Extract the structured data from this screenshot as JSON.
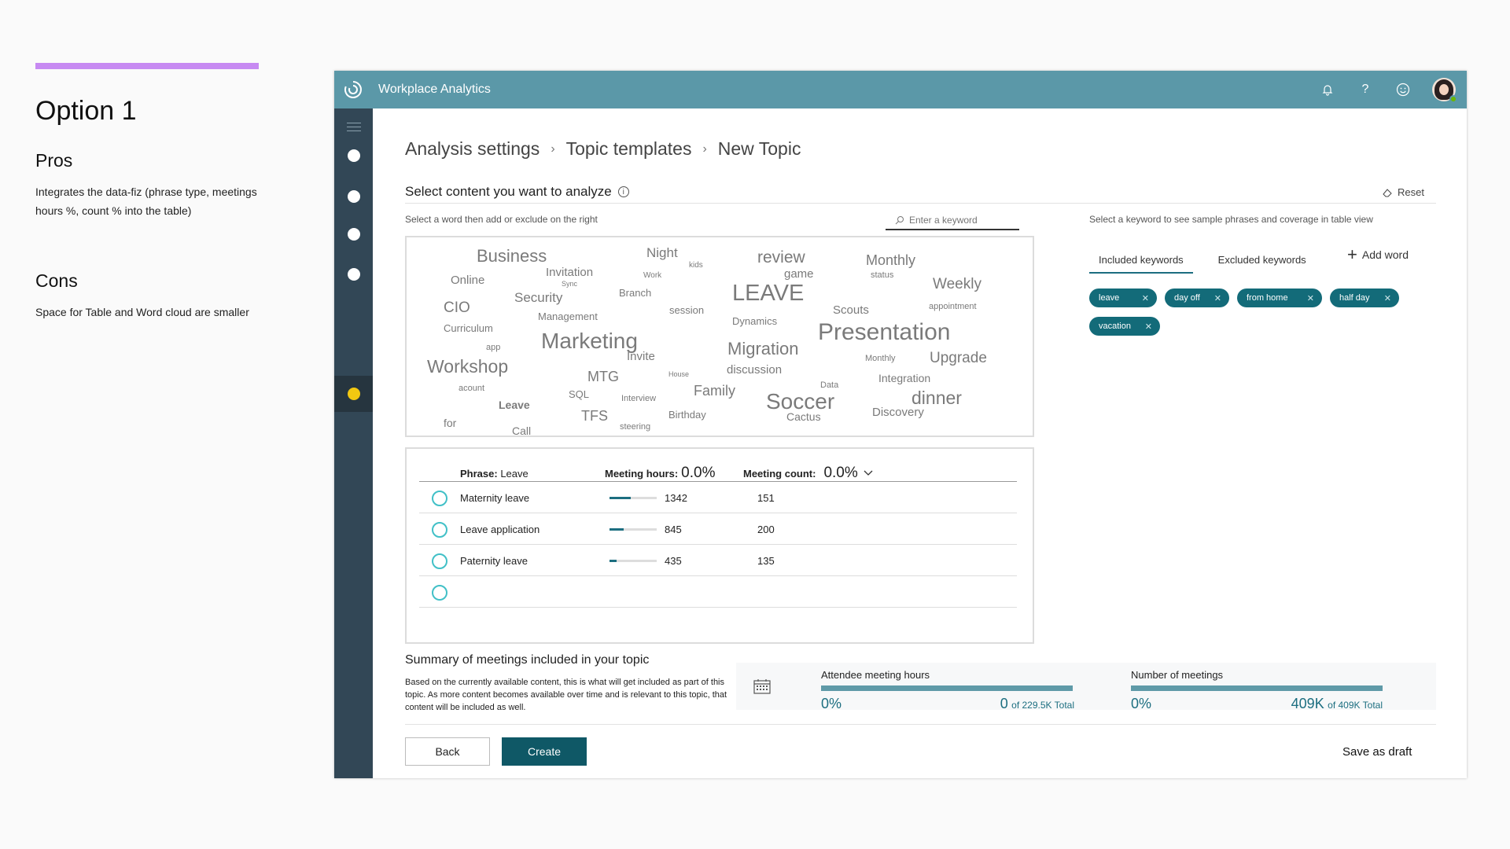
{
  "notes": {
    "heading": "Option 1",
    "pros_title": "Pros",
    "pros_text": "Integrates the data-fiz (phrase type, meetings hours %, count % into the table)",
    "cons_title": "Cons",
    "cons_text": "Space for Table and Word cloud are smaller",
    "accent_color": "#c78af2"
  },
  "app": {
    "title": "Workplace Analytics",
    "brand_color": "#5b98a8",
    "icons": [
      "bell-icon",
      "help-icon",
      "smiley-icon"
    ]
  },
  "breadcrumb": [
    "Analysis settings",
    "Topic templates",
    "New Topic"
  ],
  "section": {
    "title": "Select content you want to analyze",
    "reset_label": "Reset",
    "left_instruction": "Select a word then add or exclude on the right",
    "search_placeholder": "Enter a keyword",
    "right_instruction": "Select a keyword to see sample phrases and coverage in table view"
  },
  "word_cloud": [
    {
      "text": "Business",
      "size": 22
    },
    {
      "text": "Night",
      "size": 17
    },
    {
      "text": "kids",
      "size": 10
    },
    {
      "text": "review",
      "size": 21
    },
    {
      "text": "Monthly",
      "size": 18
    },
    {
      "text": "Invitation",
      "size": 15
    },
    {
      "text": "Online",
      "size": 15
    },
    {
      "text": "Work",
      "size": 10
    },
    {
      "text": "game",
      "size": 15
    },
    {
      "text": "status",
      "size": 11
    },
    {
      "text": "Sync",
      "size": 9
    },
    {
      "text": "Weekly",
      "size": 19
    },
    {
      "text": "Security",
      "size": 17
    },
    {
      "text": "Branch",
      "size": 13
    },
    {
      "text": "LEAVE",
      "size": 29
    },
    {
      "text": "CIO",
      "size": 19
    },
    {
      "text": "Scouts",
      "size": 15
    },
    {
      "text": "session",
      "size": 13
    },
    {
      "text": "appointment",
      "size": 11
    },
    {
      "text": "Management",
      "size": 13
    },
    {
      "text": "Dynamics",
      "size": 13
    },
    {
      "text": "Curriculum",
      "size": 13
    },
    {
      "text": "Presentation",
      "size": 30
    },
    {
      "text": "Marketing",
      "size": 28
    },
    {
      "text": "app",
      "size": 11
    },
    {
      "text": "Migration",
      "size": 22
    },
    {
      "text": "Invite",
      "size": 15
    },
    {
      "text": "Monthly",
      "size": 11
    },
    {
      "text": "Upgrade",
      "size": 19
    },
    {
      "text": "Workshop",
      "size": 23
    },
    {
      "text": "discussion",
      "size": 15
    },
    {
      "text": "House",
      "size": 9
    },
    {
      "text": "MTG",
      "size": 18
    },
    {
      "text": "Integration",
      "size": 14
    },
    {
      "text": "acount",
      "size": 11
    },
    {
      "text": "Data",
      "size": 11
    },
    {
      "text": "Family",
      "size": 18
    },
    {
      "text": "SQL",
      "size": 13
    },
    {
      "text": "Interview",
      "size": 11
    },
    {
      "text": "Leave",
      "size": 14
    },
    {
      "text": "Soccer",
      "size": 28
    },
    {
      "text": "dinner",
      "size": 23
    },
    {
      "text": "TFS",
      "size": 18
    },
    {
      "text": "Birthday",
      "size": 13
    },
    {
      "text": "Cactus",
      "size": 14
    },
    {
      "text": "Discovery",
      "size": 15
    },
    {
      "text": "for",
      "size": 14
    },
    {
      "text": "steering",
      "size": 11
    },
    {
      "text": "Call",
      "size": 14
    }
  ],
  "table": {
    "phrase_label": "Phrase:",
    "phrase_value": "Leave",
    "hours_label": "Meeting hours:",
    "hours_value": "0.0%",
    "count_label": "Meeting count:",
    "count_value": "0.0%",
    "rows": [
      {
        "name": "Maternity leave",
        "hours": "1342",
        "count": "151",
        "share": 0.45
      },
      {
        "name": "Leave application",
        "hours": "845",
        "count": "200",
        "share": 0.3
      },
      {
        "name": "Paternity leave",
        "hours": "435",
        "count": "135",
        "share": 0.15
      },
      {
        "name": "",
        "hours": "",
        "count": "",
        "share": 0
      }
    ]
  },
  "keywords": {
    "included_tab": "Included keywords",
    "excluded_tab": "Excluded keywords",
    "add_word": "Add word",
    "chips": [
      "leave",
      "day off",
      "from home",
      "half day",
      "vacation"
    ],
    "chip_color": "#136b79"
  },
  "summary": {
    "title": "Summary of meetings included in your topic",
    "text": "Based on the currently available content, this is what will get included as part of this topic. As more content becomes available over time and is relevant to this topic, that content will be included as well.",
    "attendee": {
      "label": "Attendee meeting hours",
      "pct": "0%",
      "value": "0",
      "total": "of 229.5K Total"
    },
    "meetings": {
      "label": "Number of meetings",
      "pct": "0%",
      "value": "409K",
      "total": "of 409K Total"
    }
  },
  "actions": {
    "back": "Back",
    "create": "Create",
    "save_draft": "Save as draft",
    "create_color": "#0f5866"
  }
}
